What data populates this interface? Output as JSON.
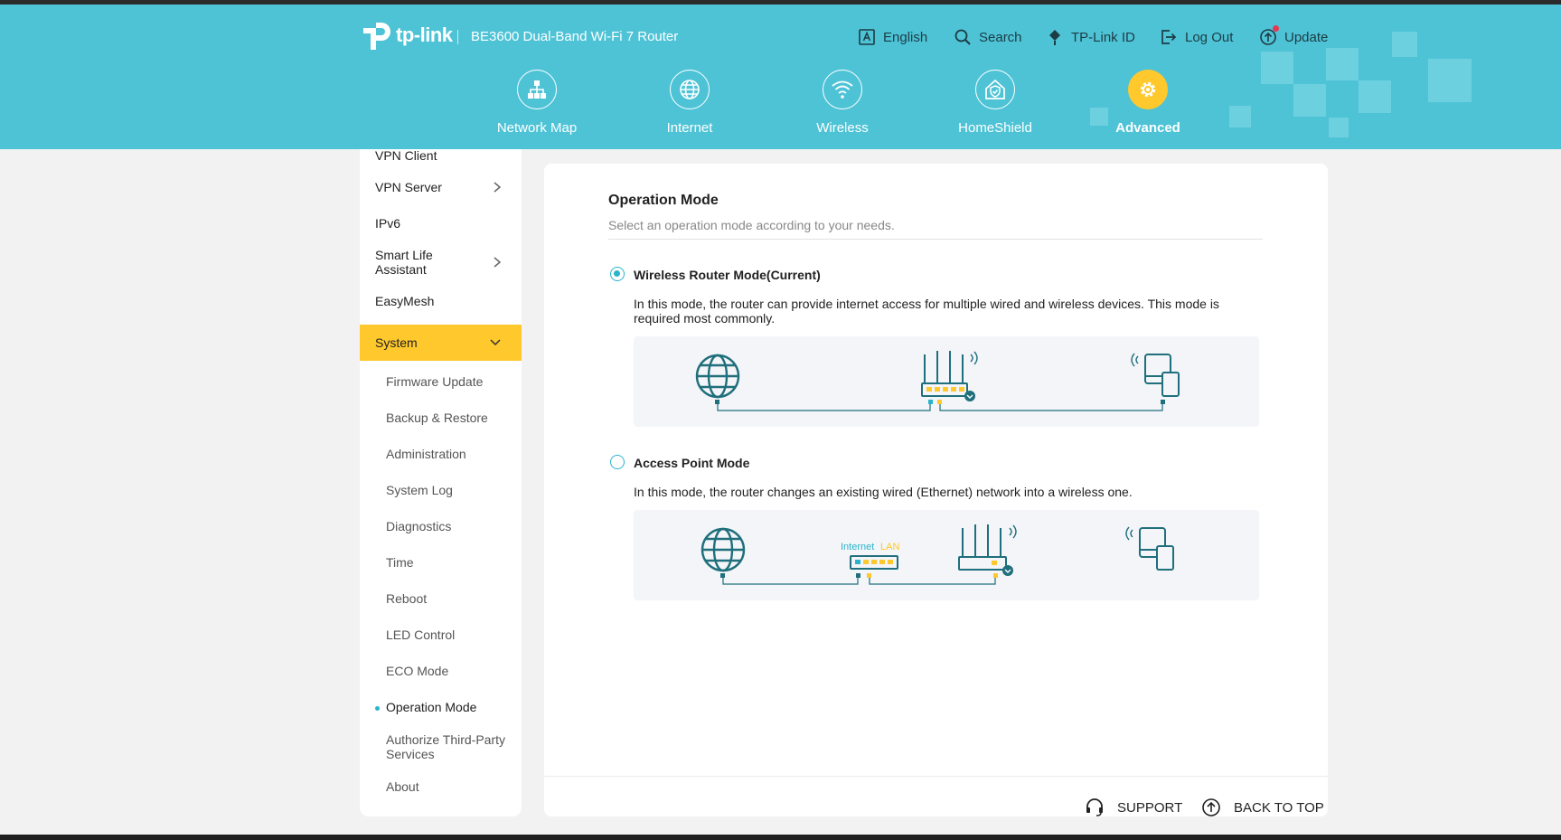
{
  "header": {
    "brand": "tp-link",
    "model": "BE3600 Dual-Band Wi-Fi 7 Router",
    "utilities": [
      {
        "icon": "language-icon",
        "label": "English"
      },
      {
        "icon": "search-icon",
        "label": "Search"
      },
      {
        "icon": "tplink-id-icon",
        "label": "TP-Link ID"
      },
      {
        "icon": "logout-icon",
        "label": "Log Out"
      },
      {
        "icon": "update-icon",
        "label": "Update"
      }
    ],
    "nav": [
      {
        "icon": "network-map-icon",
        "label": "Network Map"
      },
      {
        "icon": "globe-icon",
        "label": "Internet"
      },
      {
        "icon": "wifi-icon",
        "label": "Wireless"
      },
      {
        "icon": "homeshield-icon",
        "label": "HomeShield"
      },
      {
        "icon": "gear-icon",
        "label": "Advanced",
        "active": true
      }
    ]
  },
  "sidebar": {
    "items": [
      {
        "label": "VPN Client"
      },
      {
        "label": "VPN Server"
      },
      {
        "label": "IPv6"
      },
      {
        "label": "Smart Life Assistant"
      },
      {
        "label": "EasyMesh"
      },
      {
        "label": "System",
        "active": true
      }
    ],
    "system_children": [
      {
        "label": "Firmware Update"
      },
      {
        "label": "Backup & Restore"
      },
      {
        "label": "Administration"
      },
      {
        "label": "System Log"
      },
      {
        "label": "Diagnostics"
      },
      {
        "label": "Time"
      },
      {
        "label": "Reboot"
      },
      {
        "label": "LED Control"
      },
      {
        "label": "ECO Mode"
      },
      {
        "label": "Operation Mode",
        "active": true
      },
      {
        "label": "Authorize Third-Party Services"
      },
      {
        "label": "About"
      }
    ]
  },
  "main": {
    "title": "Operation Mode",
    "subtitle": "Select an operation mode according to your needs.",
    "modes": [
      {
        "title": "Wireless Router Mode(Current)",
        "selected": true,
        "description": "In this mode, the router can provide internet access for multiple wired and wireless devices. This mode is required most commonly."
      },
      {
        "title": "Access Point Mode",
        "selected": false,
        "description": "In this mode, the router changes an existing wired (Ethernet) network into a wireless one.",
        "diagram_labels": {
          "internet": "Internet",
          "lan": "LAN"
        }
      }
    ]
  },
  "footer": {
    "support": "SUPPORT",
    "back_to_top": "BACK TO TOP"
  },
  "colors": {
    "header_bg": "#4ec3d6",
    "accent": "#ffc82c",
    "teal": "#2ab4cc",
    "line": "#1f7c8c"
  }
}
